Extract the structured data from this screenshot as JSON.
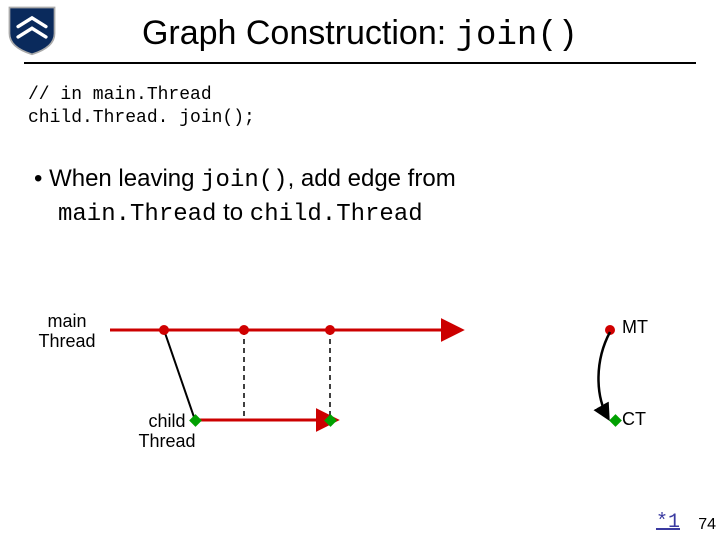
{
  "title": {
    "pre": "Graph Construction: ",
    "mono": "join()"
  },
  "code": {
    "line1": "// in main.Thread",
    "line2": "child.Thread. join();"
  },
  "bullet": {
    "pre": "• When leaving ",
    "mono1": "join()",
    "mid": ", add edge from",
    "cont_mono1": "main.Thread",
    "cont_mid": " to ",
    "cont_mono2": "child.Thread"
  },
  "labels": {
    "main": "main\nThread",
    "child": "child\nThread",
    "mt": "MT",
    "ct": "CT"
  },
  "footer": {
    "link": "*1",
    "page": "74"
  },
  "colors": {
    "shield_bg": "#0a2a5c",
    "arrow_red": "#cc0000",
    "dot_red": "#d00000",
    "dot_green": "#00a000"
  }
}
